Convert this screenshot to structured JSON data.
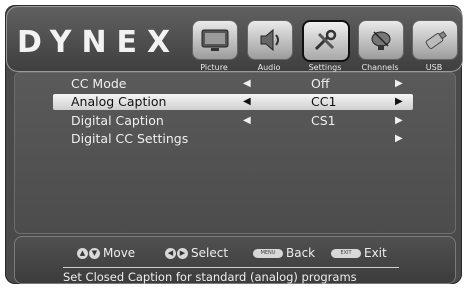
{
  "brand": "DYNEX",
  "tabs": [
    {
      "label": "Picture",
      "icon": "picture-icon"
    },
    {
      "label": "Audio",
      "icon": "audio-icon"
    },
    {
      "label": "Settings",
      "icon": "settings-icon",
      "selected": true
    },
    {
      "label": "Channels",
      "icon": "channels-icon"
    },
    {
      "label": "USB",
      "icon": "usb-icon"
    }
  ],
  "menu": [
    {
      "label": "CC Mode",
      "value": "Off",
      "left_arrow": "◀",
      "right_arrow": "▶"
    },
    {
      "label": "Analog Caption",
      "value": "CC1",
      "left_arrow": "◀",
      "right_arrow": "▶",
      "selected": true
    },
    {
      "label": "Digital Caption",
      "value": "CS1",
      "left_arrow": "◀",
      "right_arrow": "▶"
    },
    {
      "label": "Digital CC Settings",
      "value": "",
      "left_arrow": "",
      "right_arrow": "▶"
    }
  ],
  "footer": {
    "move": "Move",
    "select": "Select",
    "back": "Back",
    "exit": "Exit",
    "menu_key": "MENU",
    "exit_key": "EXIT",
    "help": "Set Closed Caption for standard (analog) programs"
  },
  "colors": {
    "selection": "#e6e6e6",
    "background": "#4a4a4a"
  }
}
